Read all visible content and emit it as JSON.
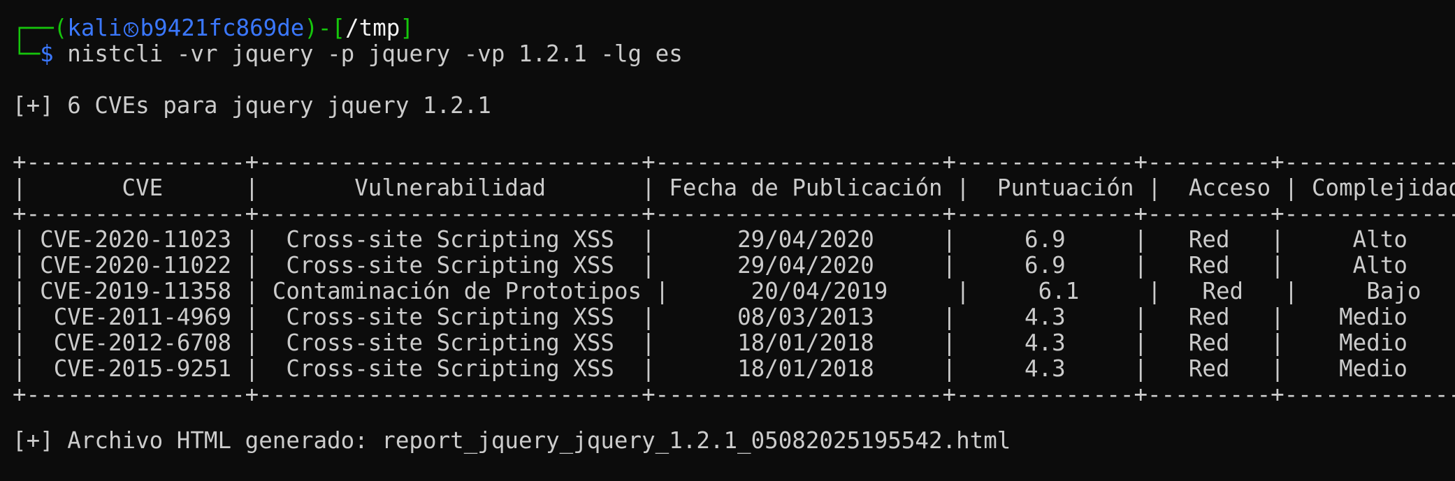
{
  "prompt": {
    "corner_top": "┌──(",
    "user": "kali",
    "host": "b9421fc869de",
    "dir_open": ")-[",
    "cwd": "/tmp",
    "dir_close": "]",
    "corner_bottom": "└─",
    "symbol": "$",
    "command": "nistcli -vr jquery -p jquery -vp 1.2.1 -lg es"
  },
  "summary": "[+] 6 CVEs para jquery jquery 1.2.1",
  "table": {
    "border": "+----------------+----------------------------+---------------------+-------------+---------+-------------+",
    "headers": [
      "CVE",
      "Vulnerabilidad",
      "Fecha de Publicación",
      "Puntuación",
      "Acceso",
      "Complejidad"
    ],
    "rows": [
      [
        "CVE-2020-11023",
        "Cross-site Scripting XSS",
        "29/04/2020",
        "6.9",
        "Red",
        "Alto"
      ],
      [
        "CVE-2020-11022",
        "Cross-site Scripting XSS",
        "29/04/2020",
        "6.9",
        "Red",
        "Alto"
      ],
      [
        "CVE-2019-11358",
        "Contaminación de Prototipos",
        "20/04/2019",
        "6.1",
        "Red",
        "Bajo"
      ],
      [
        "CVE-2011-4969",
        "Cross-site Scripting XSS",
        "08/03/2013",
        "4.3",
        "Red",
        "Medio"
      ],
      [
        "CVE-2012-6708",
        "Cross-site Scripting XSS",
        "18/01/2018",
        "4.3",
        "Red",
        "Medio"
      ],
      [
        "CVE-2015-9251",
        "Cross-site Scripting XSS",
        "18/01/2018",
        "4.3",
        "Red",
        "Medio"
      ]
    ]
  },
  "footer": "[+] Archivo HTML generado: report_jquery_jquery_1.2.1_05082025195542.html",
  "colors": {
    "background": "#0c0c0c",
    "foreground": "#cccccc",
    "prompt_green": "#16c60c",
    "prompt_blue": "#3b78ff"
  },
  "icons": {
    "host_separator": "kali-icon"
  }
}
